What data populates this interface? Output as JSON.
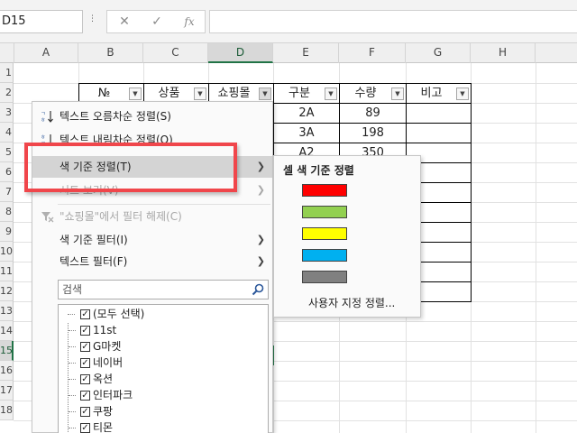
{
  "name_box": {
    "value": "D15"
  },
  "formula_bar": {
    "cancel_glyph": "✕",
    "enter_glyph": "✓",
    "fx_label": "fx",
    "formula": ""
  },
  "columns": [
    "A",
    "B",
    "C",
    "D",
    "E",
    "F",
    "G",
    "H"
  ],
  "rows": [
    "1",
    "2",
    "3",
    "4",
    "5",
    "6",
    "7",
    "8",
    "9",
    "10",
    "11",
    "12",
    "13",
    "14",
    "15",
    "16",
    "17",
    "18"
  ],
  "selected": {
    "column": "D",
    "row": "15"
  },
  "table": {
    "headers": [
      "№",
      "상품",
      "쇼핑몰",
      "구분",
      "수량",
      "비고"
    ],
    "e_values": [
      "2A",
      "3A",
      "A2"
    ],
    "f_values": [
      "89",
      "198",
      "350"
    ]
  },
  "filter_menu": {
    "sort_asc": "텍스트 오름차순 정렬(S)",
    "sort_desc": "텍스트 내림차순 정렬(O)",
    "sort_by_color": "색 기준 정렬(T)",
    "sheet_view": "시트 보기(V)",
    "clear_filter": "\"쇼핑몰\"에서 필터 해제(C)",
    "filter_by_color": "색 기준 필터(I)",
    "text_filter": "텍스트 필터(F)",
    "search_placeholder": "검색",
    "items": [
      "(모두 선택)",
      "11st",
      "G마켓",
      "네이버",
      "옥션",
      "인터파크",
      "쿠팡",
      "티몬"
    ]
  },
  "submenu": {
    "title": "셀 색 기준 정렬",
    "swatches": [
      "#ff0000",
      "#92d050",
      "#ffff00",
      "#00b0f0",
      "#808080"
    ],
    "custom_sort": "사용자 지정 정렬..."
  },
  "colors": {
    "highlight_box": "#f0464b",
    "excel_green": "#217346"
  }
}
